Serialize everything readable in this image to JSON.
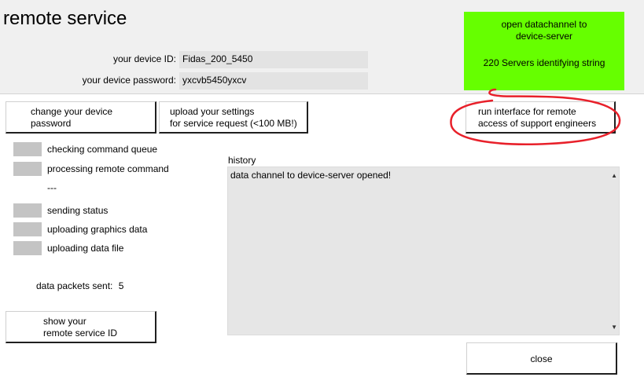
{
  "window": {
    "title": "remote service"
  },
  "device": {
    "id_label": "your device ID:",
    "id_value": "Fidas_200_5450",
    "password_label": "your device password:",
    "password_value": "yxcvb5450yxcv"
  },
  "connection_panel": {
    "open_link": "open datachannel to device-server",
    "status_text": "220 Servers identifying string",
    "color": "#66ff00"
  },
  "buttons": {
    "change_password": "change your device password",
    "upload_settings_line1": "upload your settings",
    "upload_settings_line2": "for service request (<100 MB!)",
    "run_interface_line1": "run interface for remote",
    "run_interface_line2": "access of support engineers",
    "show_id_line1": "show your",
    "show_id_line2": "remote service ID",
    "close": "close"
  },
  "status_items": [
    {
      "label": "checking command queue"
    },
    {
      "label": "processing remote command"
    },
    {
      "label": "---"
    },
    {
      "label": "sending status"
    },
    {
      "label": "uploading graphics data"
    },
    {
      "label": "uploading data file"
    }
  ],
  "packets": {
    "label": "data packets sent:",
    "value": "5"
  },
  "history": {
    "label": "history",
    "entries": [
      "data channel to device-server opened!"
    ]
  },
  "annotation": {
    "color": "#e8202a"
  }
}
